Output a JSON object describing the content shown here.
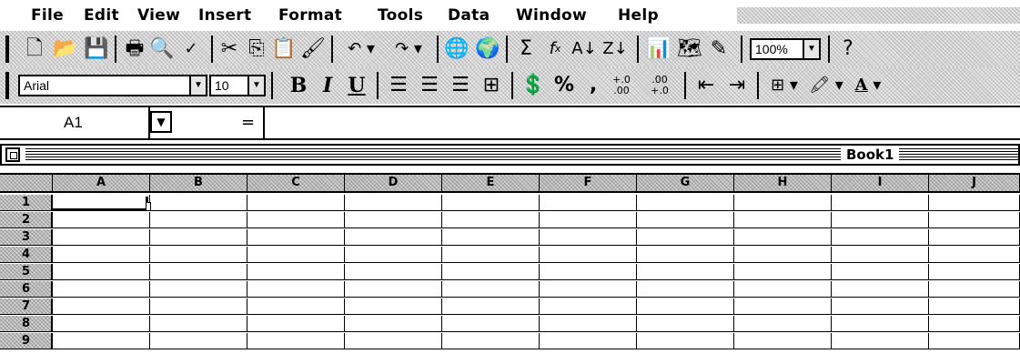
{
  "menu": {
    "items": [
      "File",
      "Edit",
      "View",
      "Insert",
      "Format",
      "Tools",
      "Data",
      "Window",
      "Help"
    ]
  },
  "toolbar_standard": {
    "zoom": "100%",
    "icons": [
      "new-icon",
      "open-icon",
      "save-icon",
      "print-icon",
      "print-preview-icon",
      "spelling-icon",
      "cut-icon",
      "copy-icon",
      "paste-icon",
      "format-painter-icon",
      "undo-icon",
      "redo-icon",
      "insert-hyperlink-icon",
      "web-toolbar-icon",
      "autosum-icon",
      "paste-function-icon",
      "sort-ascending-icon",
      "sort-descending-icon",
      "chart-wizard-icon",
      "map-icon",
      "drawing-icon",
      "help-icon"
    ]
  },
  "toolbar_format": {
    "font": "Arial",
    "size": "10",
    "bold": "B",
    "italic": "I",
    "underline": "U",
    "percent": "%",
    "comma": ",",
    "increase_decimal": "+.0 .00",
    "decrease_decimal": ".00 +.0",
    "font_color_letter": "A"
  },
  "formula_bar": {
    "name_box": "A1",
    "equals": "="
  },
  "workbook": {
    "title": "Book1"
  },
  "grid": {
    "columns": [
      "A",
      "B",
      "C",
      "D",
      "E",
      "F",
      "G",
      "H",
      "I",
      "J"
    ],
    "rows": [
      "1",
      "2",
      "3",
      "4",
      "5",
      "6",
      "7",
      "8",
      "9"
    ],
    "active_cell": "A1"
  }
}
